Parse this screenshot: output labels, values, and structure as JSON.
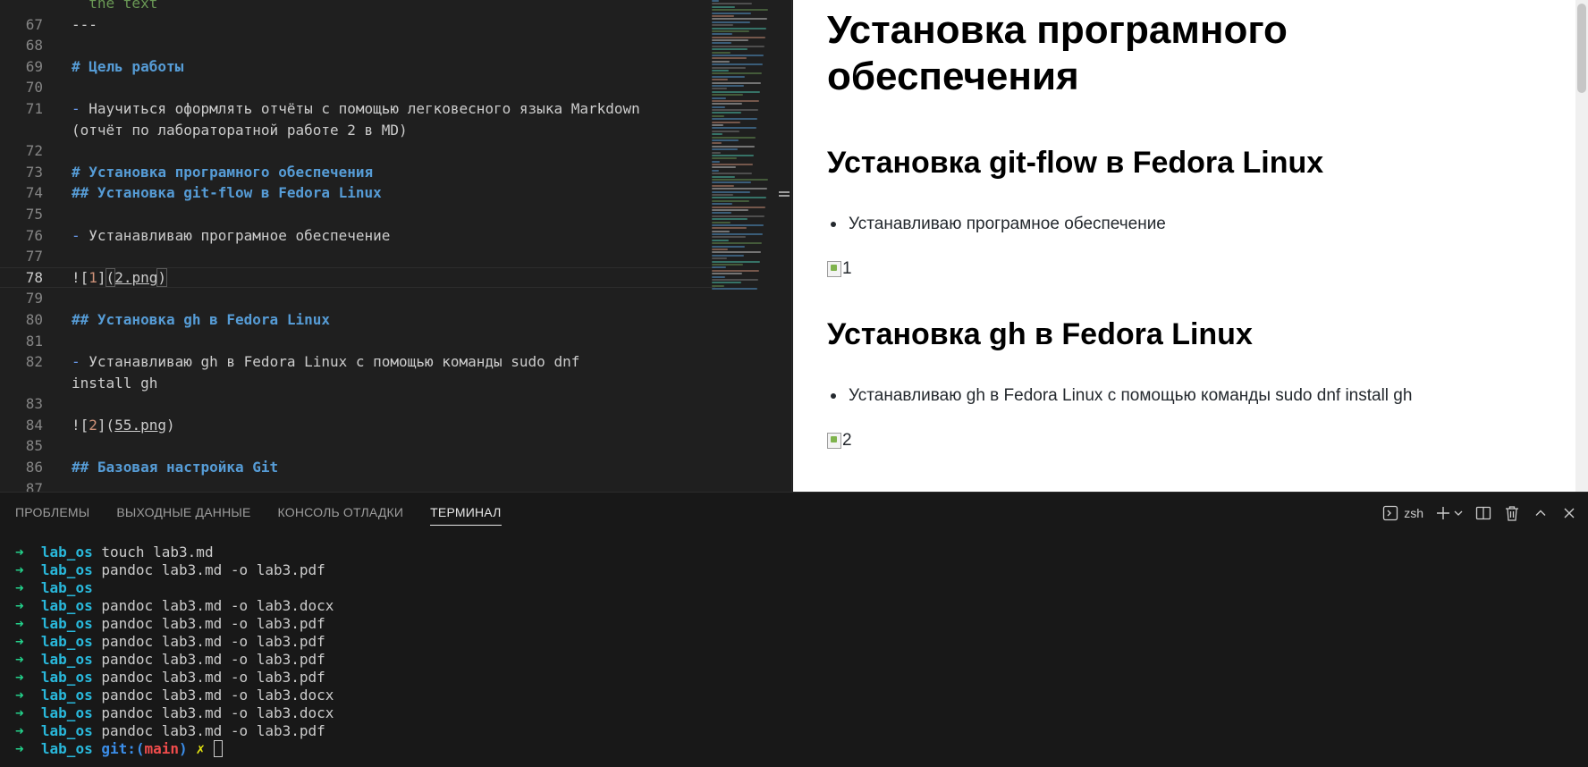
{
  "editor": {
    "lines": [
      {
        "n": "",
        "parts": [
          [
            "dim",
            "  the text"
          ]
        ]
      },
      {
        "n": "67",
        "parts": [
          [
            "",
            "---"
          ]
        ]
      },
      {
        "n": "68",
        "parts": []
      },
      {
        "n": "69",
        "parts": [
          [
            "hdr",
            "# Цель работы"
          ]
        ]
      },
      {
        "n": "70",
        "parts": []
      },
      {
        "n": "71",
        "parts": [
          [
            "dash",
            "-"
          ],
          [
            "",
            " Научиться оформлять отчёты с помощью легковесного языка Markdown"
          ]
        ]
      },
      {
        "n": "",
        "parts": [
          [
            "",
            "(отчёт по лабораторатной работе 2 в MD)"
          ]
        ]
      },
      {
        "n": "72",
        "parts": []
      },
      {
        "n": "73",
        "parts": [
          [
            "hdr",
            "# Установка програмного обеспечения"
          ]
        ]
      },
      {
        "n": "74",
        "parts": [
          [
            "hdr",
            "## Установка git-flow в Fedora Linux"
          ]
        ]
      },
      {
        "n": "75",
        "parts": []
      },
      {
        "n": "76",
        "parts": [
          [
            "dash",
            "-"
          ],
          [
            "",
            " Устанавливаю програмное обеспечение"
          ]
        ]
      },
      {
        "n": "77",
        "parts": []
      },
      {
        "n": "78",
        "current": true,
        "parts": [
          [
            "",
            "!["
          ],
          [
            "num",
            "1"
          ],
          [
            "",
            "]"
          ],
          [
            "bracket-hl",
            "("
          ],
          [
            "path",
            "2.png"
          ],
          [
            "bracket-hl",
            ")"
          ]
        ]
      },
      {
        "n": "79",
        "parts": []
      },
      {
        "n": "80",
        "parts": [
          [
            "hdr",
            "## Установка gh в Fedora Linux"
          ]
        ]
      },
      {
        "n": "81",
        "parts": []
      },
      {
        "n": "82",
        "parts": [
          [
            "dash",
            "-"
          ],
          [
            "",
            " Устанавливаю gh в Fedora Linux с помощью команды sudo dnf"
          ]
        ]
      },
      {
        "n": "",
        "parts": [
          [
            "",
            "install gh"
          ]
        ]
      },
      {
        "n": "83",
        "parts": []
      },
      {
        "n": "84",
        "parts": [
          [
            "",
            "!["
          ],
          [
            "num",
            "2"
          ],
          [
            "",
            "]("
          ],
          [
            "path",
            "55.png"
          ],
          [
            "",
            ")"
          ]
        ]
      },
      {
        "n": "85",
        "parts": []
      },
      {
        "n": "86",
        "parts": [
          [
            "hdr",
            "## Базовая настройка Git"
          ]
        ]
      },
      {
        "n": "87",
        "parts": []
      }
    ]
  },
  "preview": {
    "h1": "Установка програмного обеспечения",
    "sections": [
      {
        "h2": "Установка git-flow в Fedora Linux",
        "bullet": "Устанавливаю програмное обеспечение",
        "img_alt": "1"
      },
      {
        "h2": "Установка gh в Fedora Linux",
        "bullet": "Устанавливаю gh в Fedora Linux с помощью команды sudo dnf install gh",
        "img_alt": "2"
      }
    ]
  },
  "panel": {
    "tabs": [
      "ПРОБЛЕМЫ",
      "ВЫХОДНЫЕ ДАННЫЕ",
      "КОНСОЛЬ ОТЛАДКИ",
      "ТЕРМИНАЛ"
    ],
    "active_tab": "ТЕРМИНАЛ",
    "shell_label": "zsh"
  },
  "terminal": {
    "prompt_arrow": "➜",
    "dir": "lab_os",
    "history": [
      "touch lab3.md",
      "pandoc lab3.md -o lab3.pdf",
      "",
      "pandoc lab3.md -o lab3.docx",
      "pandoc lab3.md -o lab3.pdf",
      "pandoc lab3.md -o lab3.pdf",
      "pandoc lab3.md -o lab3.pdf",
      "pandoc lab3.md -o lab3.pdf",
      "pandoc lab3.md -o lab3.docx",
      "pandoc lab3.md -o lab3.docx",
      "pandoc lab3.md -o lab3.pdf"
    ],
    "git_label": "git:(",
    "branch": "main",
    "git_close": ")",
    "dirty_mark": "✗"
  },
  "colors": {
    "editor_bg": "#1f1f1f",
    "heading": "#569cd6",
    "prompt_arrow": "#23d18b",
    "prompt_dir": "#29b8db",
    "branch": "#f14c4c"
  },
  "icons": [
    "terminal-icon",
    "plus-icon",
    "chevron-down-icon",
    "split-icon",
    "trash-icon",
    "chevron-up-icon",
    "close-icon"
  ]
}
